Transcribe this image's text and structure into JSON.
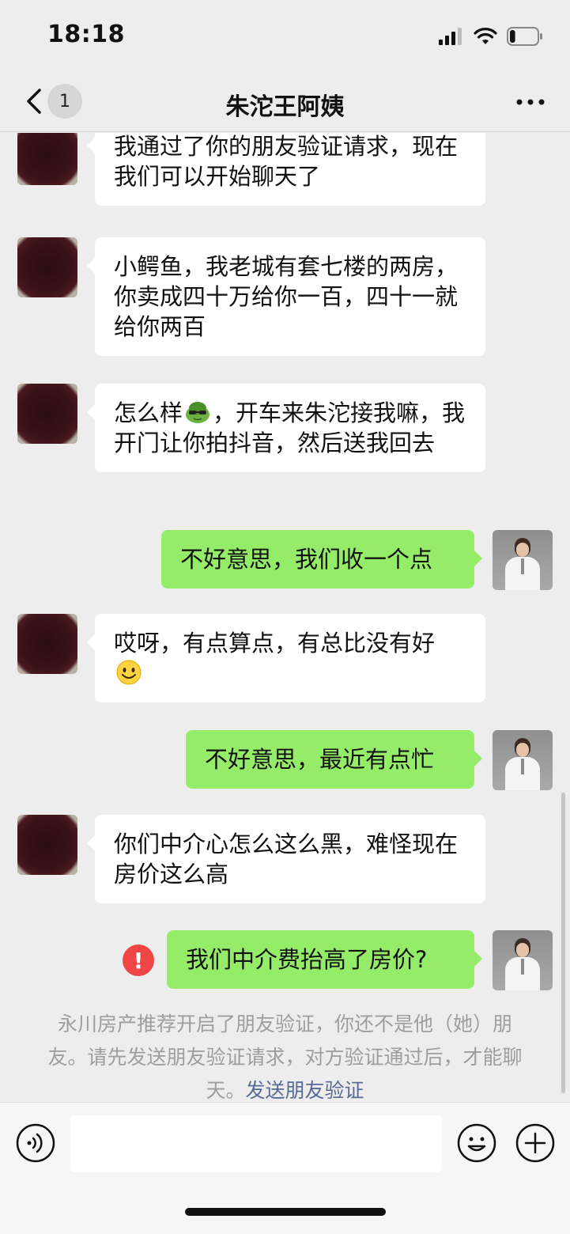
{
  "status_bar": {
    "time": "18:18",
    "battery_level": 0.2
  },
  "nav": {
    "back_icon": "chevron-left-icon",
    "unread_count": "1",
    "title": "朱沱王阿姨",
    "more_icon": "more-icon"
  },
  "messages": [
    {
      "side": "left",
      "text": "我通过了你的朋友验证请求，现在我们可以开始聊天了"
    },
    {
      "side": "left",
      "text": "小鳄鱼，我老城有套七楼的两房，你卖成四十万给你一百，四十一就给你两百"
    },
    {
      "side": "left",
      "text_before": "怎么样",
      "emoji": "turtle-sunglasses-emoji",
      "text_after": "，开车来朱沱接我嘛，我开门让你拍抖音，然后送我回去"
    },
    {
      "side": "right",
      "text": "不好意思，我们收一个点"
    },
    {
      "side": "left",
      "text": "哎呀，有点算点，有总比没有好",
      "emoji": "smile-emoji"
    },
    {
      "side": "right",
      "text": "不好意思，最近有点忙"
    },
    {
      "side": "left",
      "text": "你们中介心怎么这么黑，难怪现在房价这么高"
    },
    {
      "side": "right",
      "text": "我们中介费抬高了房价?",
      "failed": true,
      "error_icon_text": "!"
    }
  ],
  "system_notice": {
    "text": "永川房产推荐开启了朋友验证，你还不是他（她）朋友。请先发送朋友验证请求，对方验证通过后，才能聊天。",
    "link": "发送朋友验证"
  },
  "input_bar": {
    "voice_icon": "voice-icon",
    "emoji_icon": "emoji-icon",
    "plus_icon": "plus-icon"
  },
  "colors": {
    "background": "#ededed",
    "bubble_self": "#95ec69",
    "bubble_other": "#ffffff",
    "link": "#576b95",
    "error": "#f04545"
  }
}
